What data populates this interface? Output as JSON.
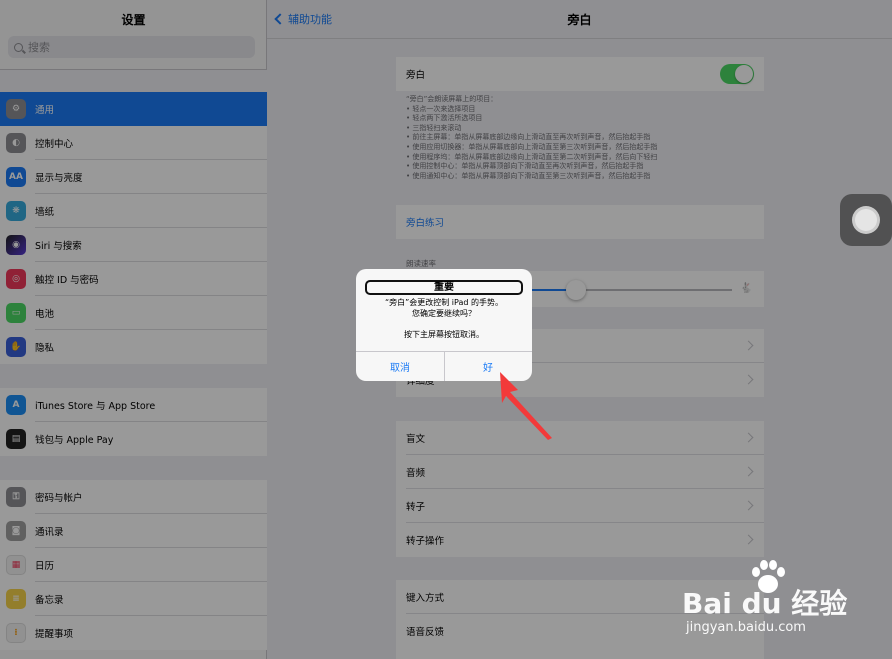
{
  "sidebar": {
    "title": "设置",
    "search_placeholder": "搜索",
    "items": [
      {
        "label": "通用",
        "icon": "gear-icon",
        "color": "#8e8e93"
      },
      {
        "label": "控制中心",
        "icon": "toggles-icon",
        "color": "#8e8e93"
      },
      {
        "label": "显示与亮度",
        "icon": "text-size-icon",
        "color": "#1b7bf6"
      },
      {
        "label": "墙纸",
        "icon": "wallpaper-icon",
        "color": "#36aadc"
      },
      {
        "label": "Siri 与搜索",
        "icon": "siri-icon",
        "color": "#222222"
      },
      {
        "label": "触控 ID 与密码",
        "icon": "fingerprint-icon",
        "color": "#f0385a"
      },
      {
        "label": "电池",
        "icon": "battery-icon",
        "color": "#4cd964"
      },
      {
        "label": "隐私",
        "icon": "hand-icon",
        "color": "#3a5fd9"
      },
      {
        "label": "iTunes Store 与 App Store",
        "icon": "app-store-icon",
        "color": "#1b8ef6"
      },
      {
        "label": "钱包与 Apple Pay",
        "icon": "wallet-icon",
        "color": "#222222"
      },
      {
        "label": "密码与帐户",
        "icon": "key-icon",
        "color": "#8e8e93"
      },
      {
        "label": "通讯录",
        "icon": "contacts-icon",
        "color": "#a0a0a0"
      },
      {
        "label": "日历",
        "icon": "calendar-icon",
        "color": "#f2f2f2"
      },
      {
        "label": "备忘录",
        "icon": "notes-icon",
        "color": "#f6d24a"
      },
      {
        "label": "提醒事项",
        "icon": "reminders-icon",
        "color": "#f2f2f2"
      }
    ]
  },
  "header": {
    "back_label": "辅助功能",
    "title": "旁白"
  },
  "main": {
    "voiceover_label": "旁白",
    "voiceover_on": true,
    "description": [
      "“旁白”会朗读屏幕上的项目：",
      "• 轻点一次来选择项目",
      "• 轻点两下激活所选项目",
      "• 三指轻扫来滚动",
      "• 前往主屏幕：单指从屏幕底部边缘向上滑动直至再次听到声音，然后抬起手指",
      "• 使用应用切换器：单指从屏幕底部向上滑动直至第三次听到声音，然后抬起手指",
      "• 使用程序坞：单指从屏幕底部边缘向上滑动直至第二次听到声音，然后向下轻扫",
      "• 使用控制中心：单指从屏幕顶部向下滑动直至再次听到声音，然后抬起手指",
      "• 使用通知中心：单指从屏幕顶部向下滑动直至第三次听到声音，然后抬起手指"
    ],
    "practice_label": "旁白练习",
    "speaking_rate_label": "朗读速率",
    "speaking_rate_value": 0.5,
    "partial_row_label": "详细度",
    "list2": [
      "盲文",
      "音频",
      "转子",
      "转子操作"
    ],
    "list3": [
      "键入方式",
      "语音反馈"
    ]
  },
  "alert": {
    "title": "重要",
    "message_line1": "“旁白”会更改控制 iPad 的手势。",
    "message_line2": "您确定要继续吗？",
    "note": "按下主屏幕按钮取消。",
    "cancel_label": "取消",
    "ok_label": "好"
  },
  "watermark": {
    "logo": "Bai  du 经验",
    "url": "jingyan.baidu.com"
  },
  "colors": {
    "accent": "#1b7bf6",
    "toggle_on": "#4cd964",
    "arrow": "#f23a3a"
  }
}
